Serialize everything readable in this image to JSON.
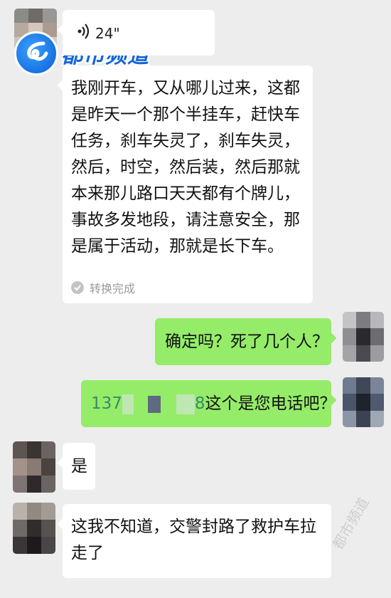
{
  "logo": {
    "text": "都市频道"
  },
  "voice_message": {
    "duration": "24\"",
    "icon": "voice-wave-icon"
  },
  "transcription": {
    "lines": [
      "我刚开车，又从哪儿过来，这都",
      "是昨天一个那个半挂车，赶快车",
      "任务，刹车失灵了，刹车失灵，",
      "然后，时空，然后装，然后那就",
      "本来那儿路口天天都有个牌儿，",
      "事故多发地段，请注意安全，那",
      "是属于活动，那就是长下车。"
    ],
    "status": "转换完成"
  },
  "messages": [
    {
      "side": "right",
      "text": "确定吗？死了几个人？"
    },
    {
      "side": "right",
      "phone_prefix": "137",
      "phone_suffix": "8",
      "text": "这个是您电话吧？"
    },
    {
      "side": "left",
      "text": "是"
    },
    {
      "side": "left",
      "lines": [
        "这我不知道，交警封路了救护车拉",
        "走了"
      ]
    }
  ],
  "watermark": "都市频道",
  "colors": {
    "background": "#ededed",
    "sent_bubble": "#95ec69",
    "received_bubble": "#ffffff",
    "phone_text": "#3a8a6a"
  }
}
